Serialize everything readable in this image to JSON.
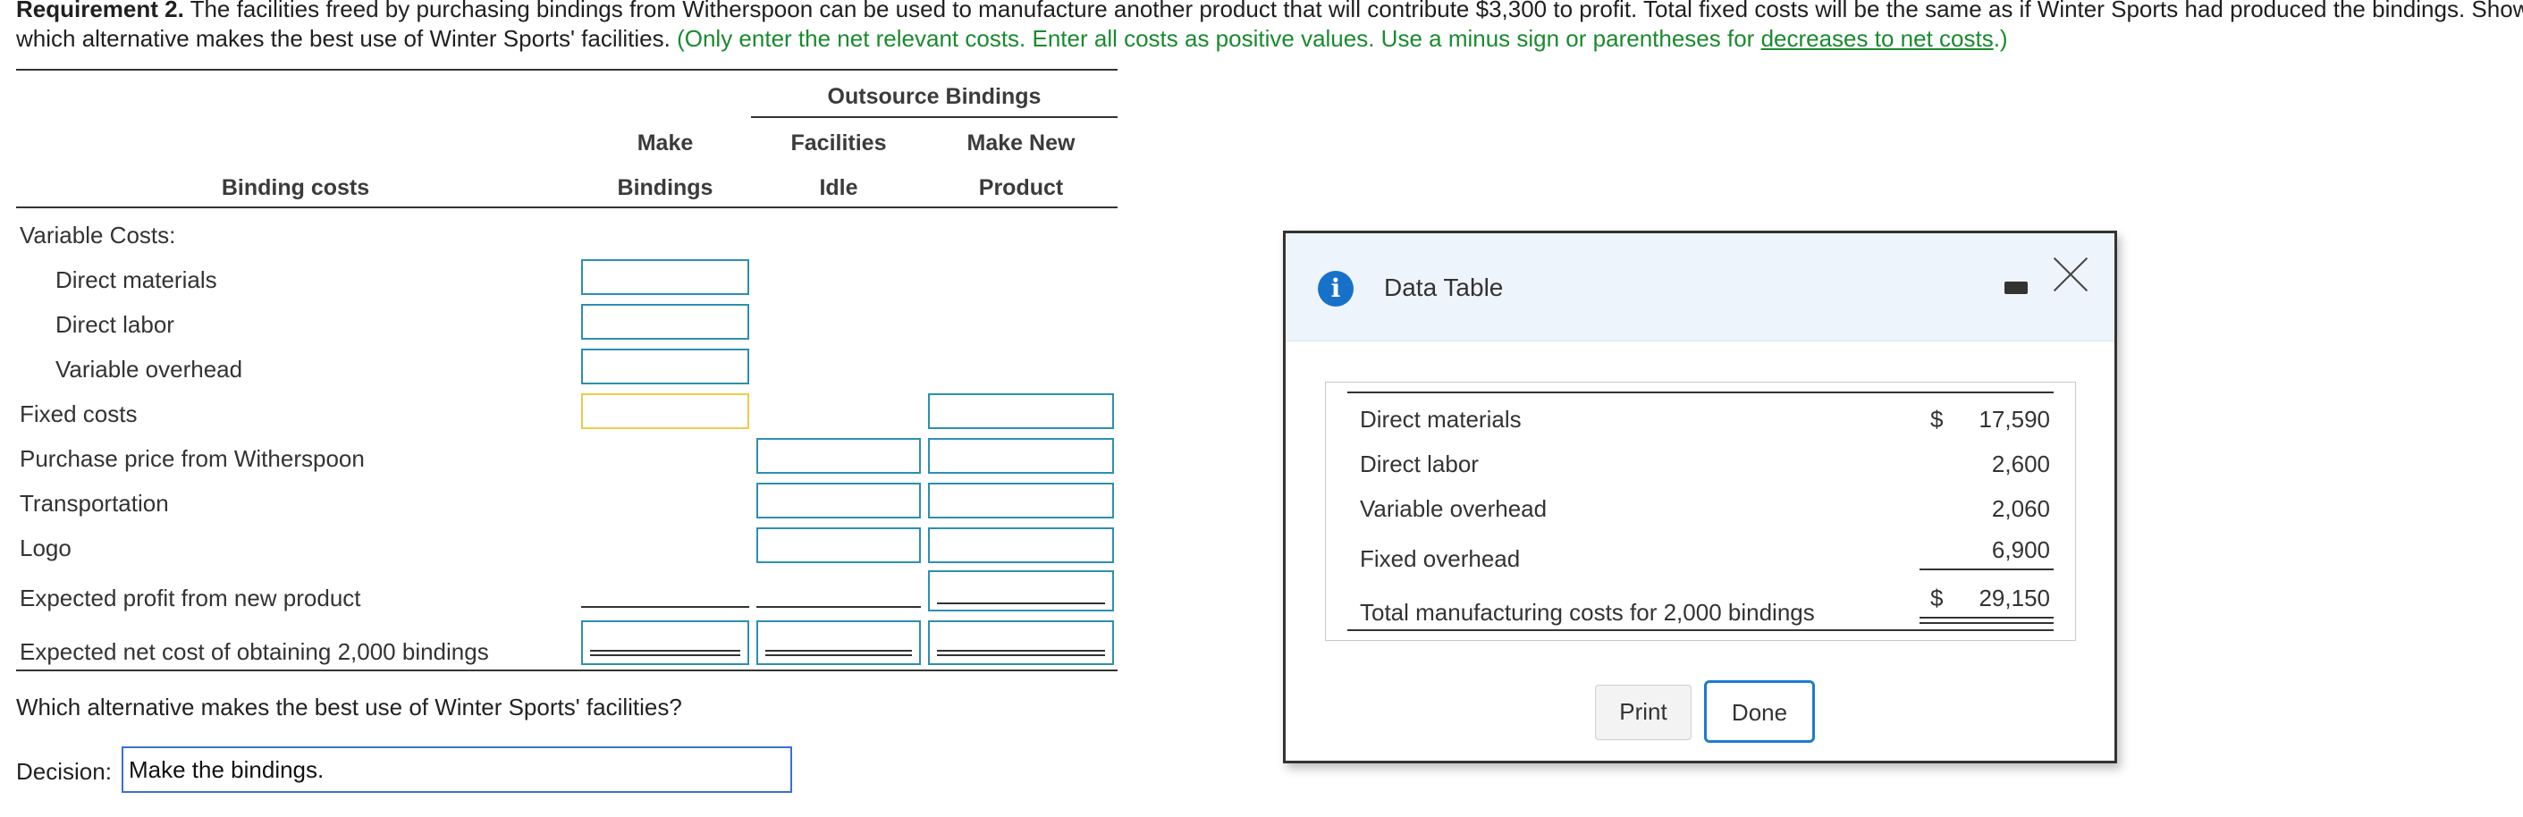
{
  "prompt": {
    "requirement_label": "Requirement 2.",
    "text_line1": "The facilities freed by purchasing bindings from Witherspoon can be used to manufacture another product that will contribute $3,300 to profit. Total fixed costs will be the same as if Winter Sports had produced the bindings. Show",
    "text_line2_black": "which alternative makes the best use of Winter Sports' facilities.",
    "instruction_part1": "(Only enter the net relevant costs. Enter all costs as positive values. Use a minus sign or parentheses for",
    "instruction_link": "decreases to net costs",
    "instruction_end": ".)"
  },
  "table": {
    "group_header": "Outsource Bindings",
    "col_make_line1": "Make",
    "col_make_line2": "Bindings",
    "col_idle_line1": "Facilities",
    "col_idle_line2": "Idle",
    "col_new_line1": "Make New",
    "col_new_line2": "Product",
    "row_header": "Binding costs",
    "rows": {
      "variable_costs": "Variable Costs:",
      "direct_materials": "Direct materials",
      "direct_labor": "Direct labor",
      "variable_overhead": "Variable overhead",
      "fixed_costs": "Fixed costs",
      "purchase_price": "Purchase price from Witherspoon",
      "transportation": "Transportation",
      "logo": "Logo",
      "expected_profit": "Expected profit from new product",
      "expected_net_cost": "Expected net cost of obtaining 2,000 bindings"
    }
  },
  "question": "Which alternative makes the best use of Winter Sports' facilities?",
  "decision": {
    "label": "Decision:",
    "value": "Make the bindings."
  },
  "dialog": {
    "title": "Data Table",
    "rows": [
      {
        "label": "Direct materials",
        "dollar": "$",
        "value": "17,590"
      },
      {
        "label": "Direct labor",
        "dollar": "",
        "value": "2,600"
      },
      {
        "label": "Variable overhead",
        "dollar": "",
        "value": "2,060"
      },
      {
        "label": "Fixed overhead",
        "dollar": "",
        "value": "6,900"
      },
      {
        "label": "Total manufacturing costs for 2,000 bindings",
        "dollar": "$",
        "value": "29,150"
      }
    ],
    "print_label": "Print",
    "done_label": "Done"
  },
  "colors": {
    "instruction_green": "#1a8a2e",
    "input_border": "#2d8fb0",
    "active_input_border": "#f0c94a",
    "info_icon": "#1672c9",
    "done_border": "#1c7ccf"
  }
}
